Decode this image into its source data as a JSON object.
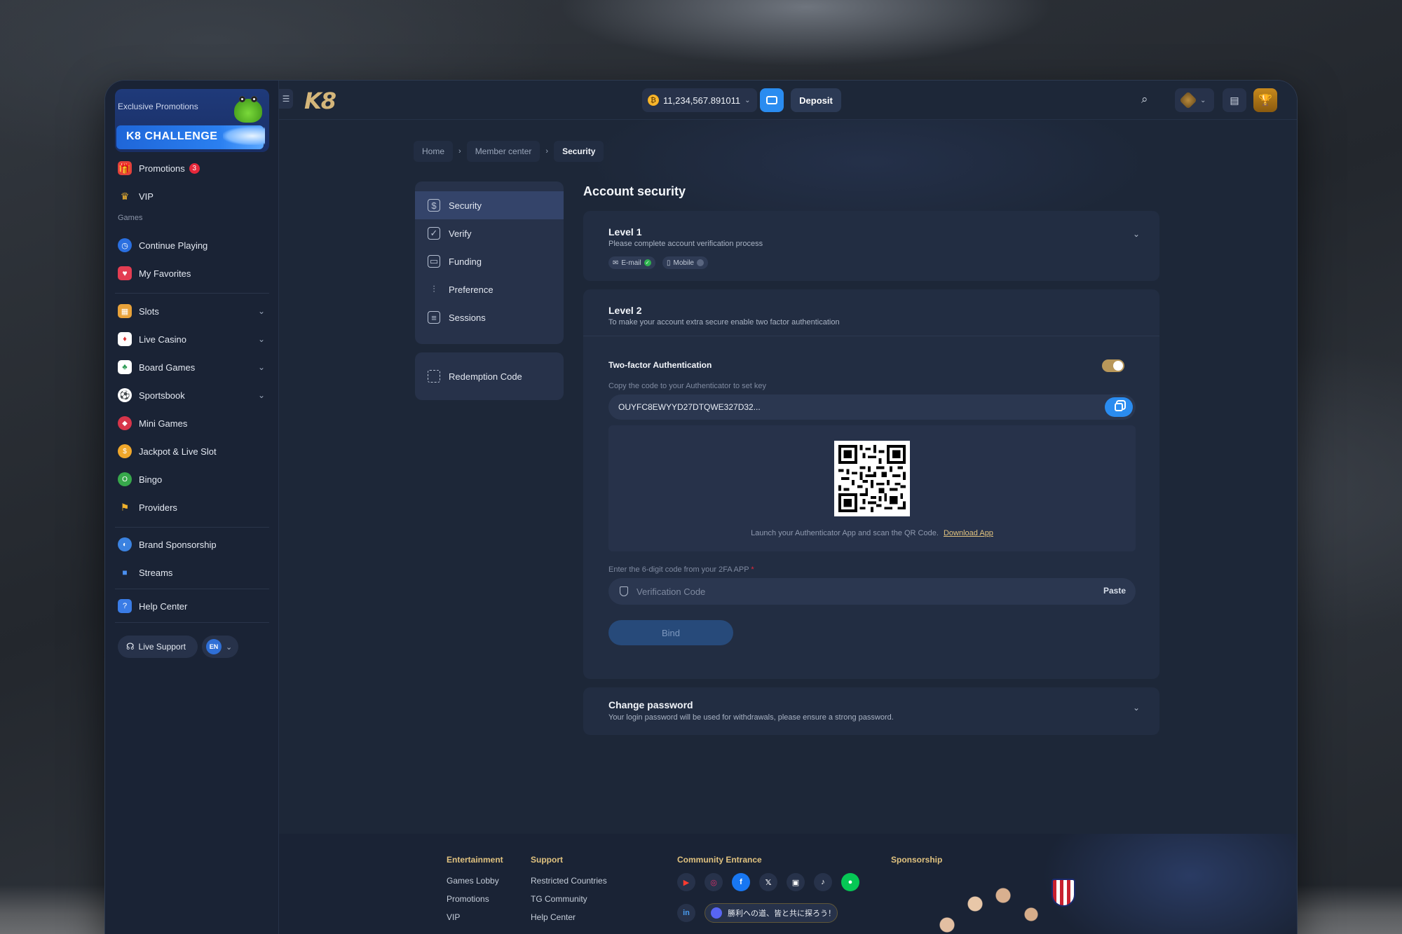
{
  "sidebar": {
    "promo": {
      "label": "Exclusive Promotions",
      "title": "K8 CHALLENGE"
    },
    "items_top": [
      {
        "label": "Promotions",
        "badge": "3",
        "icon": "gift-icon"
      },
      {
        "label": "VIP",
        "icon": "crown-icon"
      }
    ],
    "games_label": "Games",
    "items_games": [
      {
        "label": "Continue Playing",
        "icon": "history-icon"
      },
      {
        "label": "My Favorites",
        "icon": "heart-icon"
      }
    ],
    "items_categories": [
      {
        "label": "Slots",
        "icon": "slot-machine-icon",
        "expandable": true
      },
      {
        "label": "Live Casino",
        "icon": "cards-icon",
        "expandable": true
      },
      {
        "label": "Board Games",
        "icon": "board-games-icon",
        "expandable": true
      },
      {
        "label": "Sportsbook",
        "icon": "soccer-ball-icon",
        "expandable": true
      },
      {
        "label": "Mini Games",
        "icon": "mini-games-icon"
      },
      {
        "label": "Jackpot  & Live Slot",
        "icon": "jackpot-icon"
      },
      {
        "label": "Bingo",
        "icon": "bingo-icon"
      },
      {
        "label": "Providers",
        "icon": "flag-icon"
      }
    ],
    "items_more": [
      {
        "label": "Brand Sponsorship",
        "icon": "sponsorship-icon"
      },
      {
        "label": "Streams",
        "icon": "camera-icon"
      }
    ],
    "items_help": [
      {
        "label": "Help Center",
        "icon": "help-icon"
      }
    ],
    "live_support": "Live Support",
    "language": "EN"
  },
  "topbar": {
    "logo": "K8",
    "balance": "11,234,567.891011",
    "deposit": "Deposit"
  },
  "breadcrumb": [
    "Home",
    "Member center",
    "Security"
  ],
  "security_menu": {
    "items": [
      {
        "label": "Security",
        "icon": "shield-icon",
        "active": true
      },
      {
        "label": "Verify",
        "icon": "verify-icon"
      },
      {
        "label": "Funding",
        "icon": "card-icon"
      },
      {
        "label": "Preference",
        "icon": "sliders-icon"
      },
      {
        "label": "Sessions",
        "icon": "sessions-icon"
      }
    ],
    "redemption": "Redemption Code"
  },
  "content": {
    "title": "Account security",
    "level1": {
      "title": "Level 1",
      "subtitle": "Please complete account verification process",
      "email_tag": "E-mail",
      "mobile_tag": "Mobile"
    },
    "level2": {
      "title": "Level 2",
      "subtitle": "To make your account extra secure enable two factor authentication",
      "twofa_label": "Two-factor Authentication",
      "twofa_enabled": true,
      "key_label": "Copy the code to your Authenticator to set key",
      "key_value": "OUYFC8EWYYD27DTQWE327D32...",
      "qr_caption": "Launch your Authenticator App and scan the QR Code.",
      "download_app": "Download App",
      "code_label": "Enter the 6-digit code from your 2FA APP",
      "code_required": "*",
      "code_placeholder": "Verification Code",
      "paste": "Paste",
      "bind": "Bind"
    },
    "change_password": {
      "title": "Change password",
      "subtitle": "Your login password will be used for withdrawals, please ensure a strong password."
    }
  },
  "footer": {
    "entertainment": {
      "title": "Entertainment",
      "links": [
        "Games Lobby",
        "Promotions",
        "VIP"
      ]
    },
    "support": {
      "title": "Support",
      "links": [
        "Restricted Countries",
        "TG Community",
        "Help Center"
      ]
    },
    "community": {
      "title": "Community Entrance",
      "discord_text": "勝利への道、皆と共に探ろう！"
    },
    "sponsorship": {
      "title": "Sponsorship"
    }
  },
  "colors": {
    "accent": "#2a8cf0",
    "gold": "#e0c27f",
    "panel": "#222d42",
    "bg": "#1d2738"
  }
}
